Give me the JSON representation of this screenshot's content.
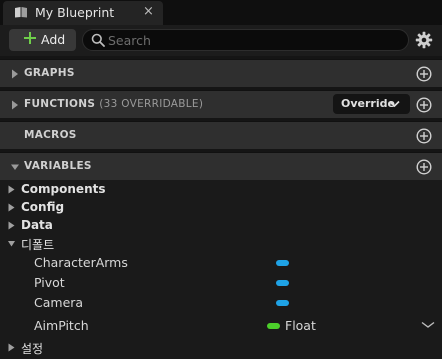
{
  "tab": {
    "title": "My Blueprint",
    "close_glyph": "×",
    "icon": "book-icon"
  },
  "toolbar": {
    "add_label": "Add",
    "search_placeholder": "Search",
    "settings_icon": "gear-icon"
  },
  "sections": {
    "graphs": {
      "title": "GRAPHS",
      "expanded": false
    },
    "functions": {
      "title": "FUNCTIONS",
      "subtitle": "(33 OVERRIDABLE)",
      "override_label": "Override",
      "expanded": false
    },
    "macros": {
      "title": "MACROS"
    },
    "variables": {
      "title": "VARIABLES",
      "expanded": true
    }
  },
  "variables": {
    "categories": [
      {
        "label": "Components",
        "expanded": false
      },
      {
        "label": "Config",
        "expanded": false
      },
      {
        "label": "Data",
        "expanded": false
      },
      {
        "label": "디폴트",
        "expanded": true
      },
      {
        "label": "설정",
        "expanded": false
      }
    ],
    "items": [
      {
        "name": "CharacterArms",
        "type_color": "#1fa3e6",
        "type_label": ""
      },
      {
        "name": "Pivot",
        "type_color": "#1fa3e6",
        "type_label": ""
      },
      {
        "name": "Camera",
        "type_color": "#1fa3e6",
        "type_label": ""
      },
      {
        "name": "AimPitch",
        "type_color": "#4ccf2b",
        "type_label": "Float"
      }
    ]
  },
  "colors": {
    "accent_green": "#6fcf4a",
    "object_reference": "#1fa3e6",
    "float_type": "#4ccf2b"
  }
}
